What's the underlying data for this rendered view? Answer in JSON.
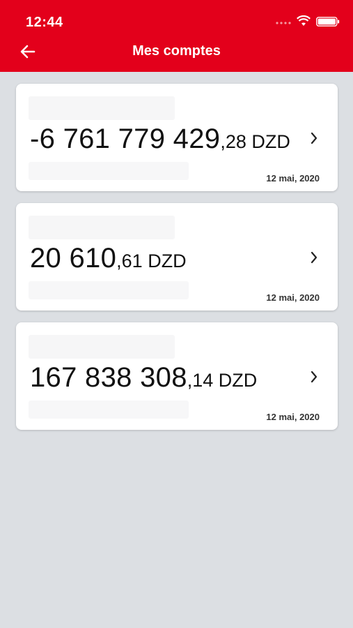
{
  "status_bar": {
    "time": "12:44"
  },
  "header": {
    "title": "Mes comptes",
    "back_icon": "arrow-left-icon"
  },
  "colors": {
    "brand_red": "#e3001b",
    "background": "#dcdfe3",
    "card": "#ffffff"
  },
  "accounts": [
    {
      "amount_int": "-6 761 779 429",
      "amount_dec": ",28 DZD",
      "date": "12 mai, 2020"
    },
    {
      "amount_int": "20 610",
      "amount_dec": ",61 DZD",
      "date": "12 mai, 2020"
    },
    {
      "amount_int": "167 838 308",
      "amount_dec": ",14 DZD",
      "date": "12 mai, 2020"
    }
  ]
}
